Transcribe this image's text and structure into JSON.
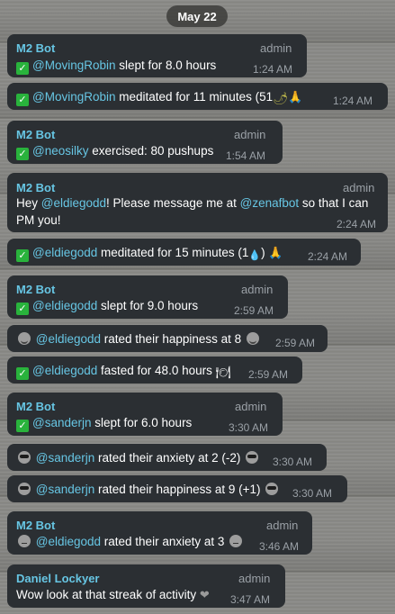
{
  "date": "May 22",
  "messages": [
    {
      "sender": "M2 Bot",
      "role": "admin",
      "mention": "@MovingRobin",
      "text": " slept for 8.0 hours",
      "time": "1:24 AM"
    },
    {
      "mention": "@MovingRobin",
      "text": " meditated for 11 minutes (51",
      "time": "1:24 AM"
    },
    {
      "sender": "M2 Bot",
      "role": "admin",
      "mention": "@neosilky",
      "text": " exercised: 80 pushups",
      "time": "1:54 AM"
    },
    {
      "sender": "M2 Bot",
      "role": "admin",
      "text_a": "Hey ",
      "mention_a": "@eldiegodd",
      "text_b": "! Please message me at ",
      "mention_b": "@zenafbot",
      "text_c": " so that I can PM you!",
      "time": "2:24 AM"
    },
    {
      "mention": "@eldiegodd",
      "text": " meditated for 15 minutes (1",
      "time": "2:24 AM"
    },
    {
      "sender": "M2 Bot",
      "role": "admin",
      "mention": "@eldiegodd",
      "text": " slept for 9.0 hours",
      "time": "2:59 AM"
    },
    {
      "mention": "@eldiegodd",
      "text": " rated their happiness at 8",
      "time": "2:59 AM"
    },
    {
      "mention": "@eldiegodd",
      "text": " fasted for 48.0 hours",
      "time": "2:59 AM"
    },
    {
      "sender": "M2 Bot",
      "role": "admin",
      "mention": "@sanderjn",
      "text": " slept for 6.0 hours",
      "time": "3:30 AM"
    },
    {
      "mention": "@sanderjn",
      "text": " rated their anxiety at 2 (-2)",
      "time": "3:30 AM"
    },
    {
      "mention": "@sanderjn",
      "text": " rated their happiness at 9 (+1)",
      "time": "3:30 AM"
    },
    {
      "sender": "M2 Bot",
      "role": "admin",
      "mention": "@eldiegodd",
      "text": " rated their anxiety at 3",
      "time": "3:46 AM"
    },
    {
      "sender": "Daniel Lockyer",
      "role": "admin",
      "text": "Wow look at that streak of activity",
      "time": "3:47 AM"
    }
  ],
  "icons": {
    "check": "check-mark-icon",
    "pray": "folded-hands-icon",
    "sunglasses": "sunglasses-face-icon",
    "neutral": "neutral-face-icon",
    "smile": "smiling-face-icon",
    "plate": "plate-icon",
    "drop": "drop-icon",
    "pepper": "pepper-icon",
    "heart": "heart-icon"
  },
  "colors": {
    "bubble": "#2b2f33",
    "accent": "#67c6e4",
    "check": "#29b33c",
    "meta": "#9aa0a6"
  }
}
